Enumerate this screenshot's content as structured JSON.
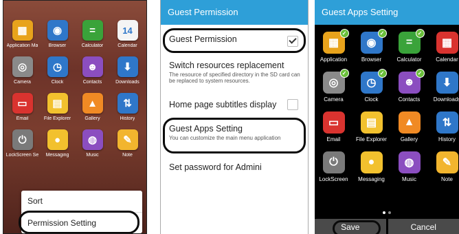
{
  "launcher": {
    "apps": [
      {
        "label": "Application Ma",
        "icon": "application-manager-icon",
        "color": "#e8a31c",
        "glyph": "▦"
      },
      {
        "label": "Browser",
        "icon": "browser-icon",
        "color": "#2f77c9",
        "glyph": "◉"
      },
      {
        "label": "Calculator",
        "icon": "calculator-icon",
        "color": "#3aa33a",
        "glyph": "="
      },
      {
        "label": "Calendar",
        "icon": "calendar-icon",
        "color": "#f4f4f4",
        "glyph": "14"
      },
      {
        "label": "Camera",
        "icon": "camera-icon",
        "color": "#8a8a8a",
        "glyph": "◎"
      },
      {
        "label": "Clock",
        "icon": "clock-icon",
        "color": "#2f77c9",
        "glyph": "◷"
      },
      {
        "label": "Contacts",
        "icon": "contacts-icon",
        "color": "#8b4ec0",
        "glyph": "☻"
      },
      {
        "label": "Downloads",
        "icon": "downloads-icon",
        "color": "#2f77c9",
        "glyph": "⬇"
      },
      {
        "label": "Email",
        "icon": "email-icon",
        "color": "#d9332f",
        "glyph": "▭"
      },
      {
        "label": "File Explorer",
        "icon": "file-explorer-icon",
        "color": "#f2c12e",
        "glyph": "▤"
      },
      {
        "label": "Gallery",
        "icon": "gallery-icon",
        "color": "#f08a24",
        "glyph": "▲"
      },
      {
        "label": "History",
        "icon": "history-icon",
        "color": "#2f77c9",
        "glyph": "⇅"
      },
      {
        "label": "LockScreen Se",
        "icon": "lockscreen-icon",
        "color": "#7a7a7a",
        "glyph": "⏻"
      },
      {
        "label": "Messaging",
        "icon": "messaging-icon",
        "color": "#f2c12e",
        "glyph": "●"
      },
      {
        "label": "Music",
        "icon": "music-icon",
        "color": "#8b4ec0",
        "glyph": "◍"
      },
      {
        "label": "Note",
        "icon": "note-icon",
        "color": "#f2b52e",
        "glyph": "✎"
      }
    ],
    "menu": {
      "sort": "Sort",
      "permission_setting": "Permission Setting"
    }
  },
  "guest_permission": {
    "title": "Guest Permission",
    "items": [
      {
        "title": "Guest Permission",
        "subtitle": "",
        "checkbox": true,
        "checked": true
      },
      {
        "title": "Switch resources replacement",
        "subtitle": "The resource of specified directory in the SD card can be replaced to system resources.",
        "checkbox": false,
        "checked": false
      },
      {
        "title": "Home page subtitles display",
        "subtitle": "",
        "checkbox": true,
        "checked": false
      },
      {
        "title": "Guest Apps Setting",
        "subtitle": "You can customize the main menu application",
        "checkbox": false,
        "checked": false
      },
      {
        "title": "Set password for Admini",
        "subtitle": "",
        "checkbox": false,
        "checked": false
      }
    ]
  },
  "guest_apps": {
    "title": "Guest Apps Setting",
    "apps": [
      {
        "label": "Application",
        "icon": "application-manager-icon",
        "color": "#e8a31c",
        "glyph": "▦",
        "selected": true
      },
      {
        "label": "Browser",
        "icon": "browser-icon",
        "color": "#2f77c9",
        "glyph": "◉",
        "selected": true
      },
      {
        "label": "Calculator",
        "icon": "calculator-icon",
        "color": "#3aa33a",
        "glyph": "=",
        "selected": true
      },
      {
        "label": "Calendar",
        "icon": "calendar-icon",
        "color": "#d9332f",
        "glyph": "▦",
        "selected": false
      },
      {
        "label": "Camera",
        "icon": "camera-icon",
        "color": "#8a8a8a",
        "glyph": "◎",
        "selected": true
      },
      {
        "label": "Clock",
        "icon": "clock-icon",
        "color": "#2f77c9",
        "glyph": "◷",
        "selected": true
      },
      {
        "label": "Contacts",
        "icon": "contacts-icon",
        "color": "#8b4ec0",
        "glyph": "☻",
        "selected": true
      },
      {
        "label": "Downloads",
        "icon": "downloads-icon",
        "color": "#2f77c9",
        "glyph": "⬇",
        "selected": false
      },
      {
        "label": "Email",
        "icon": "email-icon",
        "color": "#d9332f",
        "glyph": "▭",
        "selected": false
      },
      {
        "label": "File Explorer",
        "icon": "file-explorer-icon",
        "color": "#f2c12e",
        "glyph": "▤",
        "selected": false
      },
      {
        "label": "Gallery",
        "icon": "gallery-icon",
        "color": "#f08a24",
        "glyph": "▲",
        "selected": false
      },
      {
        "label": "History",
        "icon": "history-icon",
        "color": "#2f77c9",
        "glyph": "⇅",
        "selected": false
      },
      {
        "label": "LockScreen",
        "icon": "lockscreen-icon",
        "color": "#7a7a7a",
        "glyph": "⏻",
        "selected": false
      },
      {
        "label": "Messaging",
        "icon": "messaging-icon",
        "color": "#f2c12e",
        "glyph": "●",
        "selected": false
      },
      {
        "label": "Music",
        "icon": "music-icon",
        "color": "#8b4ec0",
        "glyph": "◍",
        "selected": false
      },
      {
        "label": "Note",
        "icon": "note-icon",
        "color": "#f2b52e",
        "glyph": "✎",
        "selected": false
      }
    ],
    "save_label": "Save",
    "cancel_label": "Cancel"
  },
  "colors": {
    "accent": "#2e9fd8",
    "highlight": "#0b0b0b",
    "check_badge": "#6abf3a"
  }
}
